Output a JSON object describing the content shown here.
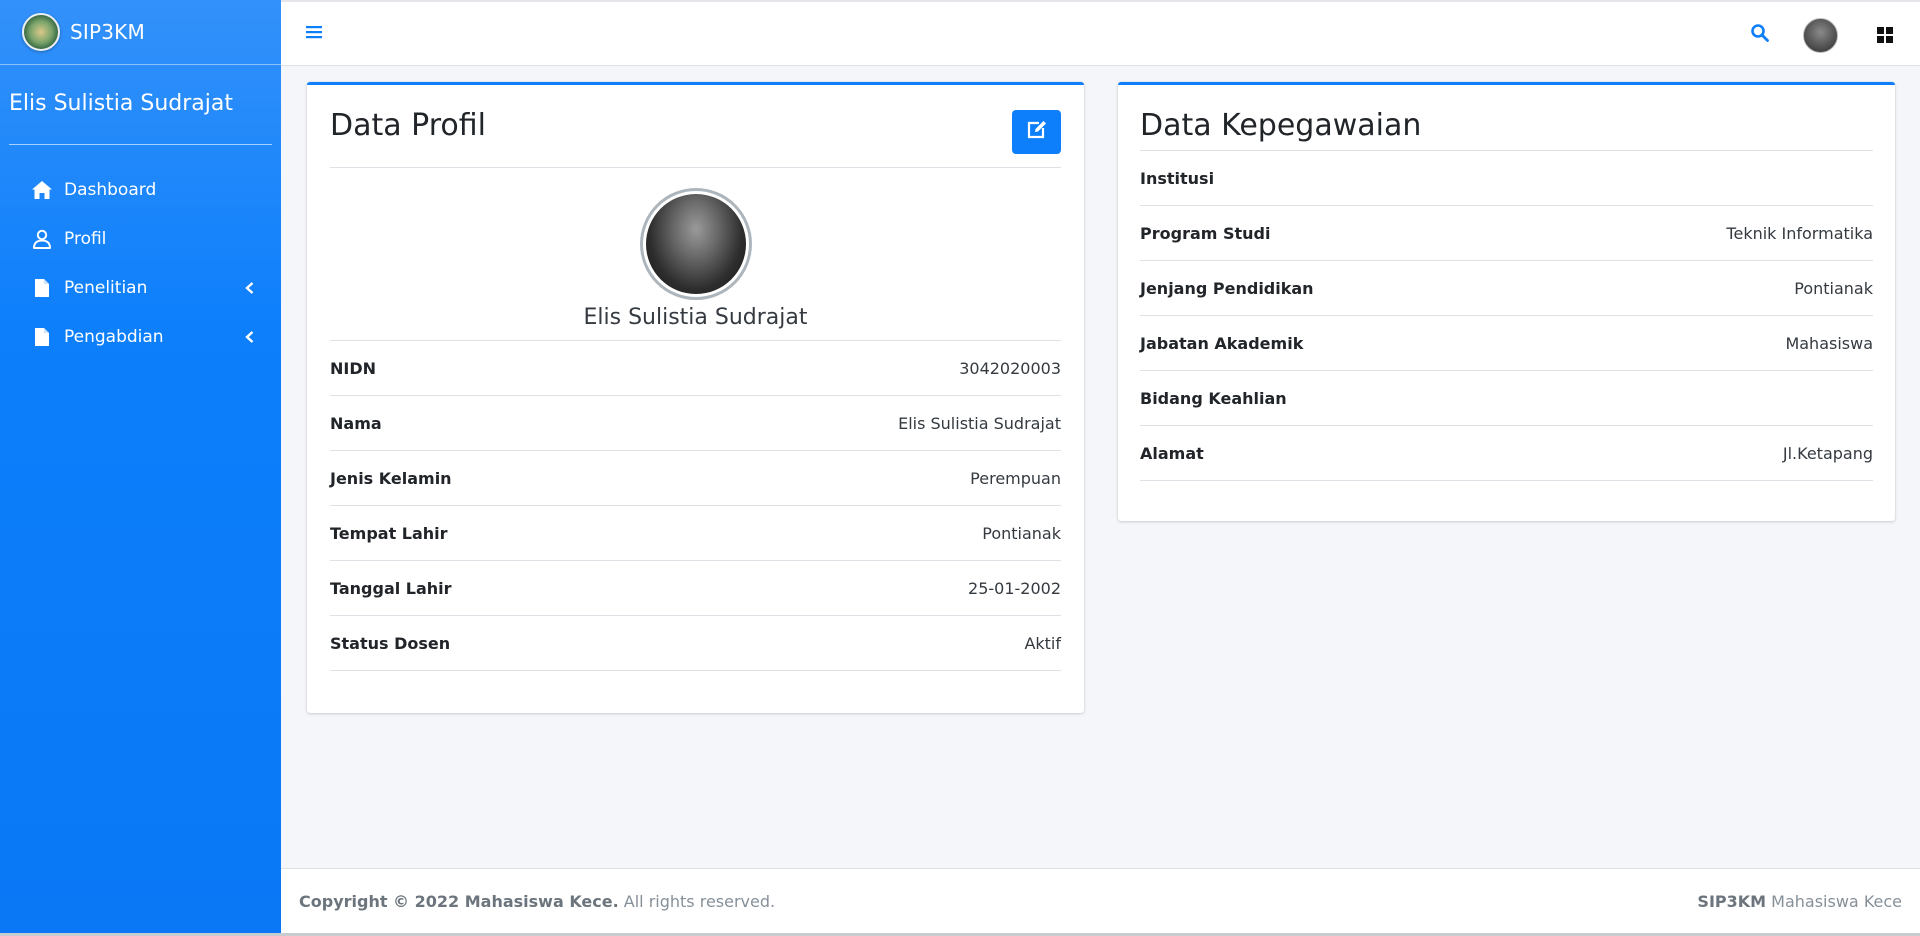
{
  "app": {
    "brand": "SIP3KM"
  },
  "sidebar": {
    "user_name": "Elis Sulistia Sudrajat",
    "items": [
      {
        "label": "Dashboard",
        "icon": "home-icon"
      },
      {
        "label": "Profil",
        "icon": "user-icon"
      },
      {
        "label": "Penelitian",
        "icon": "file-icon",
        "has_submenu": true
      },
      {
        "label": "Pengabdian",
        "icon": "file-icon",
        "has_submenu": true
      }
    ]
  },
  "topbar": {
    "icons": [
      "hamburger-icon",
      "search-icon",
      "avatar",
      "grid-icon"
    ]
  },
  "profile_card": {
    "title": "Data Profil",
    "name": "Elis Sulistia Sudrajat",
    "rows": [
      {
        "key": "NIDN",
        "value": "3042020003"
      },
      {
        "key": "Nama",
        "value": "Elis Sulistia Sudrajat"
      },
      {
        "key": "Jenis Kelamin",
        "value": "Perempuan"
      },
      {
        "key": "Tempat Lahir",
        "value": "Pontianak"
      },
      {
        "key": "Tanggal Lahir",
        "value": "25-01-2002"
      },
      {
        "key": "Status Dosen",
        "value": "Aktif"
      }
    ]
  },
  "employment_card": {
    "title": "Data Kepegawaian",
    "rows": [
      {
        "key": "Institusi",
        "value": ""
      },
      {
        "key": "Program Studi",
        "value": "Teknik Informatika"
      },
      {
        "key": "Jenjang Pendidikan",
        "value": "Pontianak"
      },
      {
        "key": "Jabatan Akademik",
        "value": "Mahasiswa"
      },
      {
        "key": "Bidang Keahlian",
        "value": ""
      },
      {
        "key": "Alamat",
        "value": "Jl.Ketapang"
      }
    ]
  },
  "footer": {
    "copyright_bold": "Copyright © 2022 Mahasiswa Kece.",
    "copyright_rest": " All rights reserved.",
    "right_bold": "SIP3KM",
    "right_rest": " Mahasiswa Kece"
  },
  "colors": {
    "primary": "#0d7ffb",
    "background": "#f4f6f9"
  }
}
